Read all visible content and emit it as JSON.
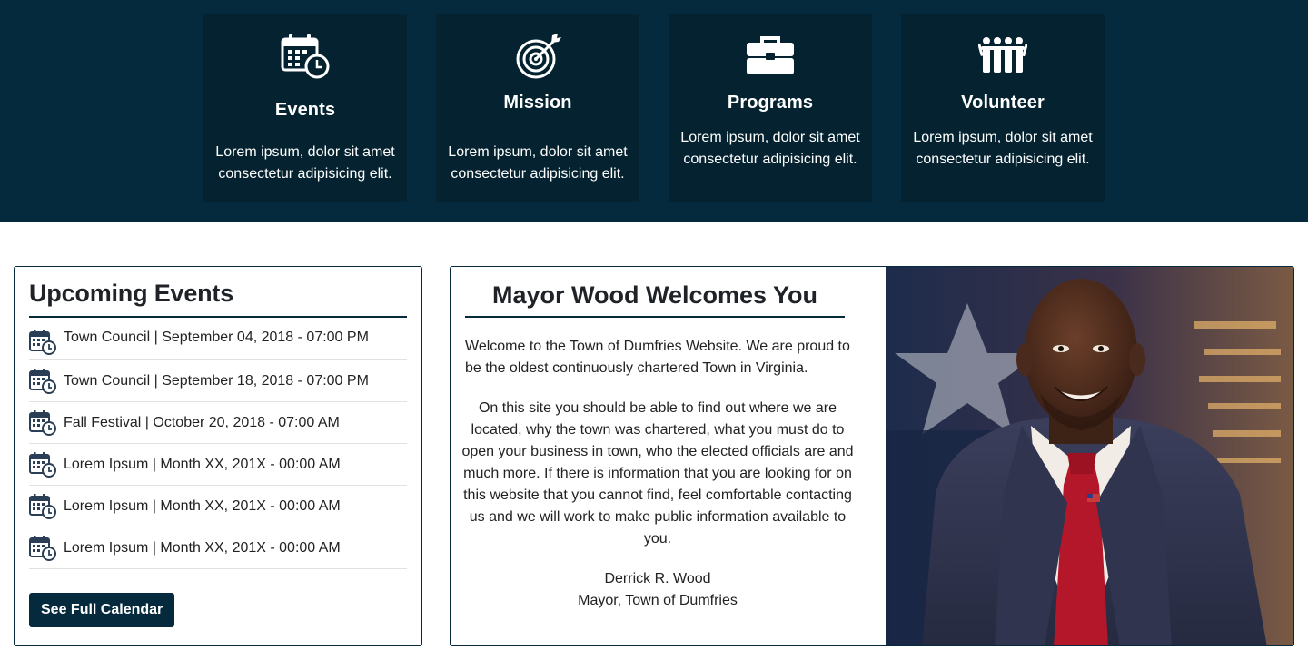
{
  "features": [
    {
      "title": "Events",
      "desc": "Lorem ipsum, dolor sit amet consectetur adipisicing elit.",
      "icon": "calendar-clock-icon"
    },
    {
      "title": "Mission",
      "desc": "Lorem ipsum, dolor sit amet consectetur adipisicing elit.",
      "icon": "target-icon"
    },
    {
      "title": "Programs",
      "desc": "Lorem ipsum, dolor sit amet consectetur adipisicing elit.",
      "icon": "briefcase-icon"
    },
    {
      "title": "Volunteer",
      "desc": "Lorem ipsum, dolor sit amet consectetur adipisicing elit.",
      "icon": "people-raising-hands-icon"
    }
  ],
  "events": {
    "title": "Upcoming Events",
    "items": [
      "Town Council | September 04, 2018 - 07:00 PM",
      "Town Council | September 18, 2018 - 07:00 PM",
      "Fall Festival | October 20, 2018 - 07:00 AM",
      "Lorem Ipsum | Month XX, 201X - 00:00 AM",
      "Lorem Ipsum | Month XX, 201X - 00:00 AM",
      "Lorem Ipsum | Month XX, 201X - 00:00 AM"
    ],
    "button_label": "See Full Calendar"
  },
  "welcome": {
    "title": "Mayor Wood Welcomes You",
    "para1": "Welcome to the Town of Dumfries Website. We are proud to be the oldest continuously chartered Town in Virginia.",
    "para2": "On this site you should be able to find out where we are located, why the town was chartered, what you must do to open your business in town, who the elected officials are and much more. If there is information that you are looking for on this website that you cannot find, feel comfortable contacting us and we will work to make public information available to you.",
    "signature_name": "Derrick R. Wood",
    "signature_title": "Mayor, Town of Dumfries"
  },
  "colors": {
    "band": "#062a3d",
    "card": "#04222f",
    "accent": "#062a3d",
    "tie": "#b5172a"
  }
}
